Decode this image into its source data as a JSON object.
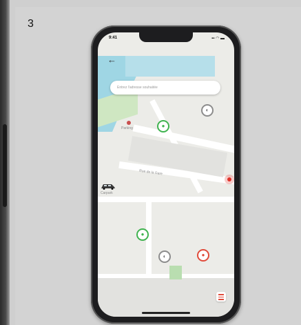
{
  "step": {
    "number": "3"
  },
  "phone": {
    "status_bar": {
      "time": "9:41",
      "icons": "▪▪ ◠ ▬"
    },
    "search": {
      "placeholder": "Entrez l'adresse souhaitée"
    },
    "map": {
      "labels": [
        "Parking",
        "Rue de la Gare",
        "Carpark"
      ]
    },
    "markers": [
      {
        "type": "green",
        "glyph": "●"
      },
      {
        "type": "gray",
        "glyph": "◐"
      },
      {
        "type": "green",
        "glyph": "●"
      },
      {
        "type": "gray",
        "glyph": "◐"
      },
      {
        "type": "red",
        "glyph": "●"
      }
    ]
  },
  "colors": {
    "accent_green": "#3fb34f",
    "accent_red": "#e04b3a",
    "water": "#9fd6e4",
    "park": "#b9deb0"
  }
}
